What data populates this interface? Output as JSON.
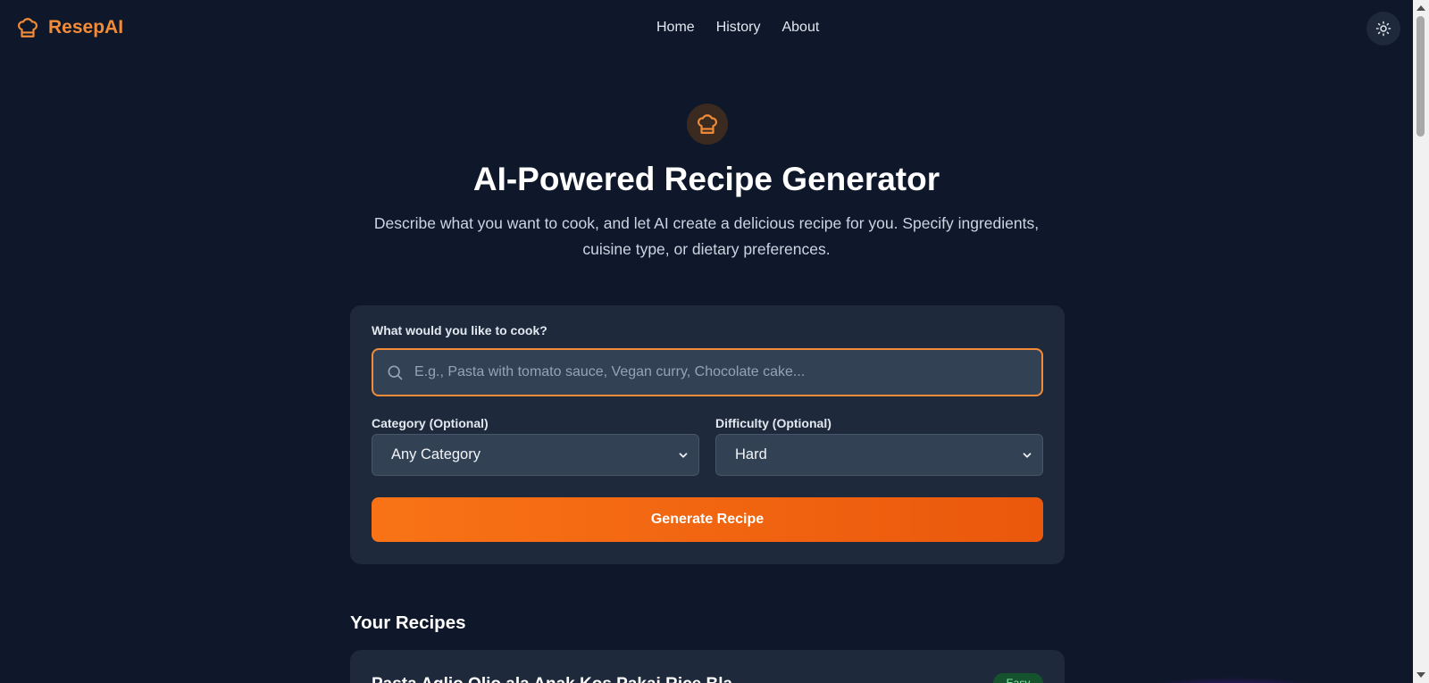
{
  "brand": {
    "name": "ResepAI",
    "icon": "chef-hat-icon"
  },
  "nav": {
    "links": [
      "Home",
      "History",
      "About"
    ]
  },
  "theme_toggle": {
    "icon": "sun-icon"
  },
  "hero": {
    "icon": "chef-hat-icon",
    "title": "AI-Powered Recipe Generator",
    "subtitle": "Describe what you want to cook, and let AI create a delicious recipe for you. Specify ingredients, cuisine type, or dietary preferences."
  },
  "form": {
    "prompt_label": "What would you like to cook?",
    "prompt_value": "",
    "prompt_placeholder": "E.g., Pasta with tomato sauce, Vegan curry, Chocolate cake...",
    "category_label": "Category (Optional)",
    "category_value": "Any Category",
    "difficulty_label": "Difficulty (Optional)",
    "difficulty_value": "Hard",
    "generate_label": "Generate Recipe"
  },
  "recipes": {
    "title": "Your Recipes",
    "items": [
      {
        "title": "Pasta Aglio Olio ala Anak Kos Pakai Rice Bla",
        "badge": "Easy"
      }
    ]
  },
  "colors": {
    "accent": "#f28c38",
    "background": "#0f172a",
    "card": "#1e293b",
    "input": "#334155"
  }
}
